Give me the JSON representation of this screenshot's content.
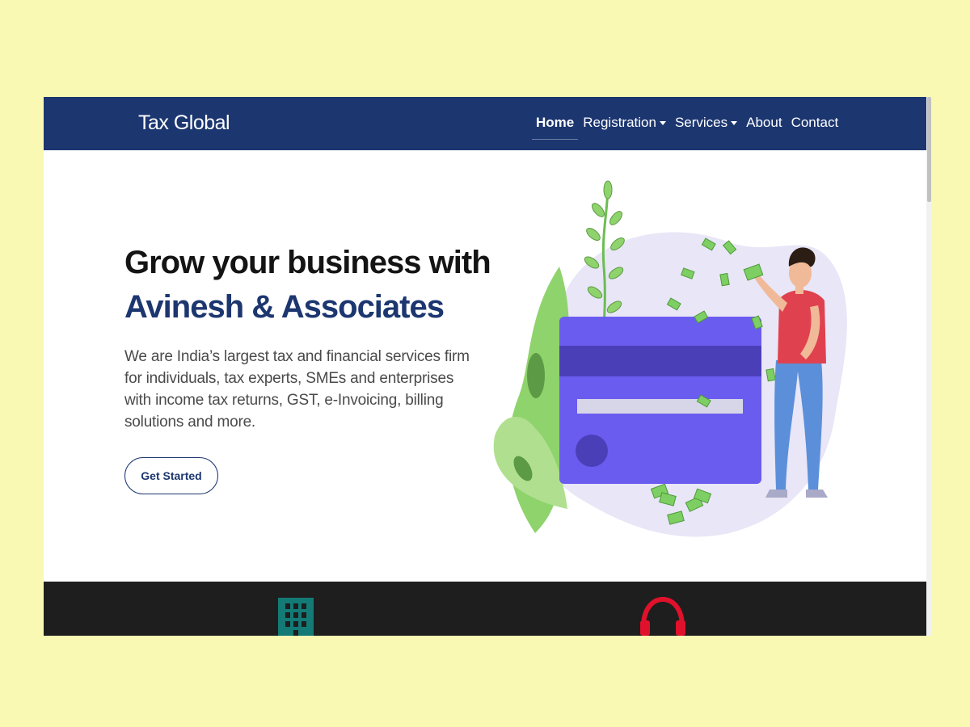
{
  "navbar": {
    "brand": "Tax Global",
    "items": [
      {
        "label": "Home",
        "active": true,
        "dropdown": false
      },
      {
        "label": "Registration",
        "active": false,
        "dropdown": true
      },
      {
        "label": "Services",
        "active": false,
        "dropdown": true
      },
      {
        "label": "About",
        "active": false,
        "dropdown": false
      },
      {
        "label": "Contact",
        "active": false,
        "dropdown": false
      }
    ]
  },
  "hero": {
    "title_line1": "Grow your business with",
    "title_line2": "Avinesh & Associates",
    "description": "We are India’s largest tax and financial services firm for individuals, tax experts, SMEs and enterprises with income tax returns, GST, e-Invoicing, billing solutions and more.",
    "cta_label": "Get Started",
    "illustration": "credit-card-money-illustration"
  },
  "features": {
    "icons": [
      "building-icon",
      "headset-icon"
    ]
  },
  "colors": {
    "navbar": "#1c3670",
    "accent": "#1c3670",
    "background": "#f9f9b4",
    "card": "#6b5cf0",
    "dark_band": "#1e1e1e",
    "building_icon": "#137a76",
    "headset_icon": "#e0112b"
  }
}
